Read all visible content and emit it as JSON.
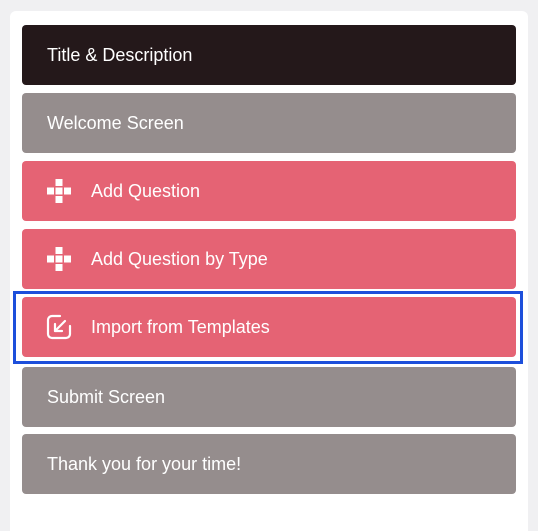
{
  "colors": {
    "dark": "#24181a",
    "gray": "#958d8d",
    "accent": "#e56374",
    "selection": "#1d4fdb"
  },
  "menu": {
    "title_description": {
      "label": "Title & Description"
    },
    "welcome_screen": {
      "label": "Welcome Screen"
    },
    "add_question": {
      "label": "Add Question",
      "icon": "plus-icon"
    },
    "add_question_by_type": {
      "label": "Add Question by Type",
      "icon": "plus-icon"
    },
    "import_templates": {
      "label": "Import from Templates",
      "icon": "import-icon",
      "selected": true
    },
    "submit_screen": {
      "label": "Submit Screen"
    },
    "thank_you": {
      "label": "Thank you for your time!"
    }
  }
}
